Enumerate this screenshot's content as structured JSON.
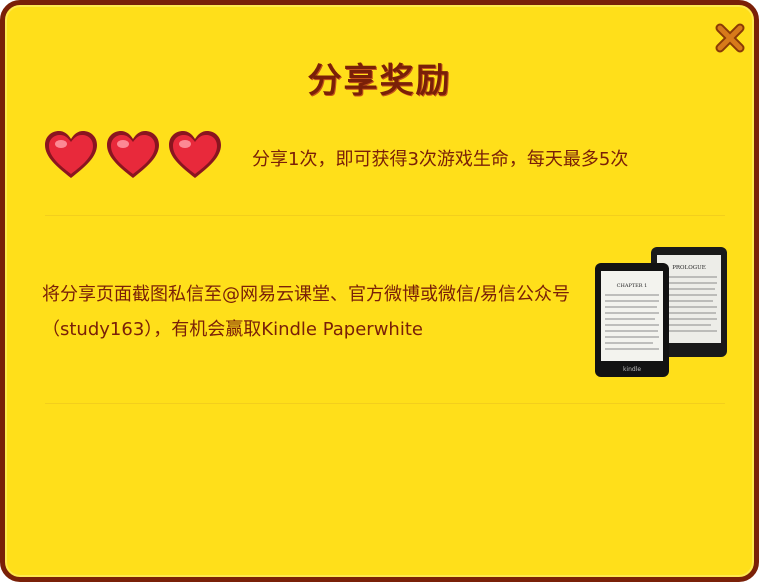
{
  "dialog": {
    "title": "分享奖励",
    "close_icon": "close-x-icon"
  },
  "reward_daily": {
    "hearts": [
      "heart-icon",
      "heart-icon",
      "heart-icon"
    ],
    "text": "分享1次，即可获得3次游戏生命，每天最多5次"
  },
  "reward_prize": {
    "text": "将分享页面截图私信至@网易云课堂、官方微博或微信/易信公众号（study163），有机会赢取Kindle Paperwhite",
    "image": "kindle-paperwhite-image",
    "screen_front_heading": "CHAPTER 1",
    "screen_back_heading": "PROLOGUE",
    "brand": "kindle"
  },
  "colors": {
    "background": "#FFDF1A",
    "border": "#7A2008",
    "text": "#7A2008",
    "close": "#D0701A",
    "heart": "#E8293B"
  }
}
